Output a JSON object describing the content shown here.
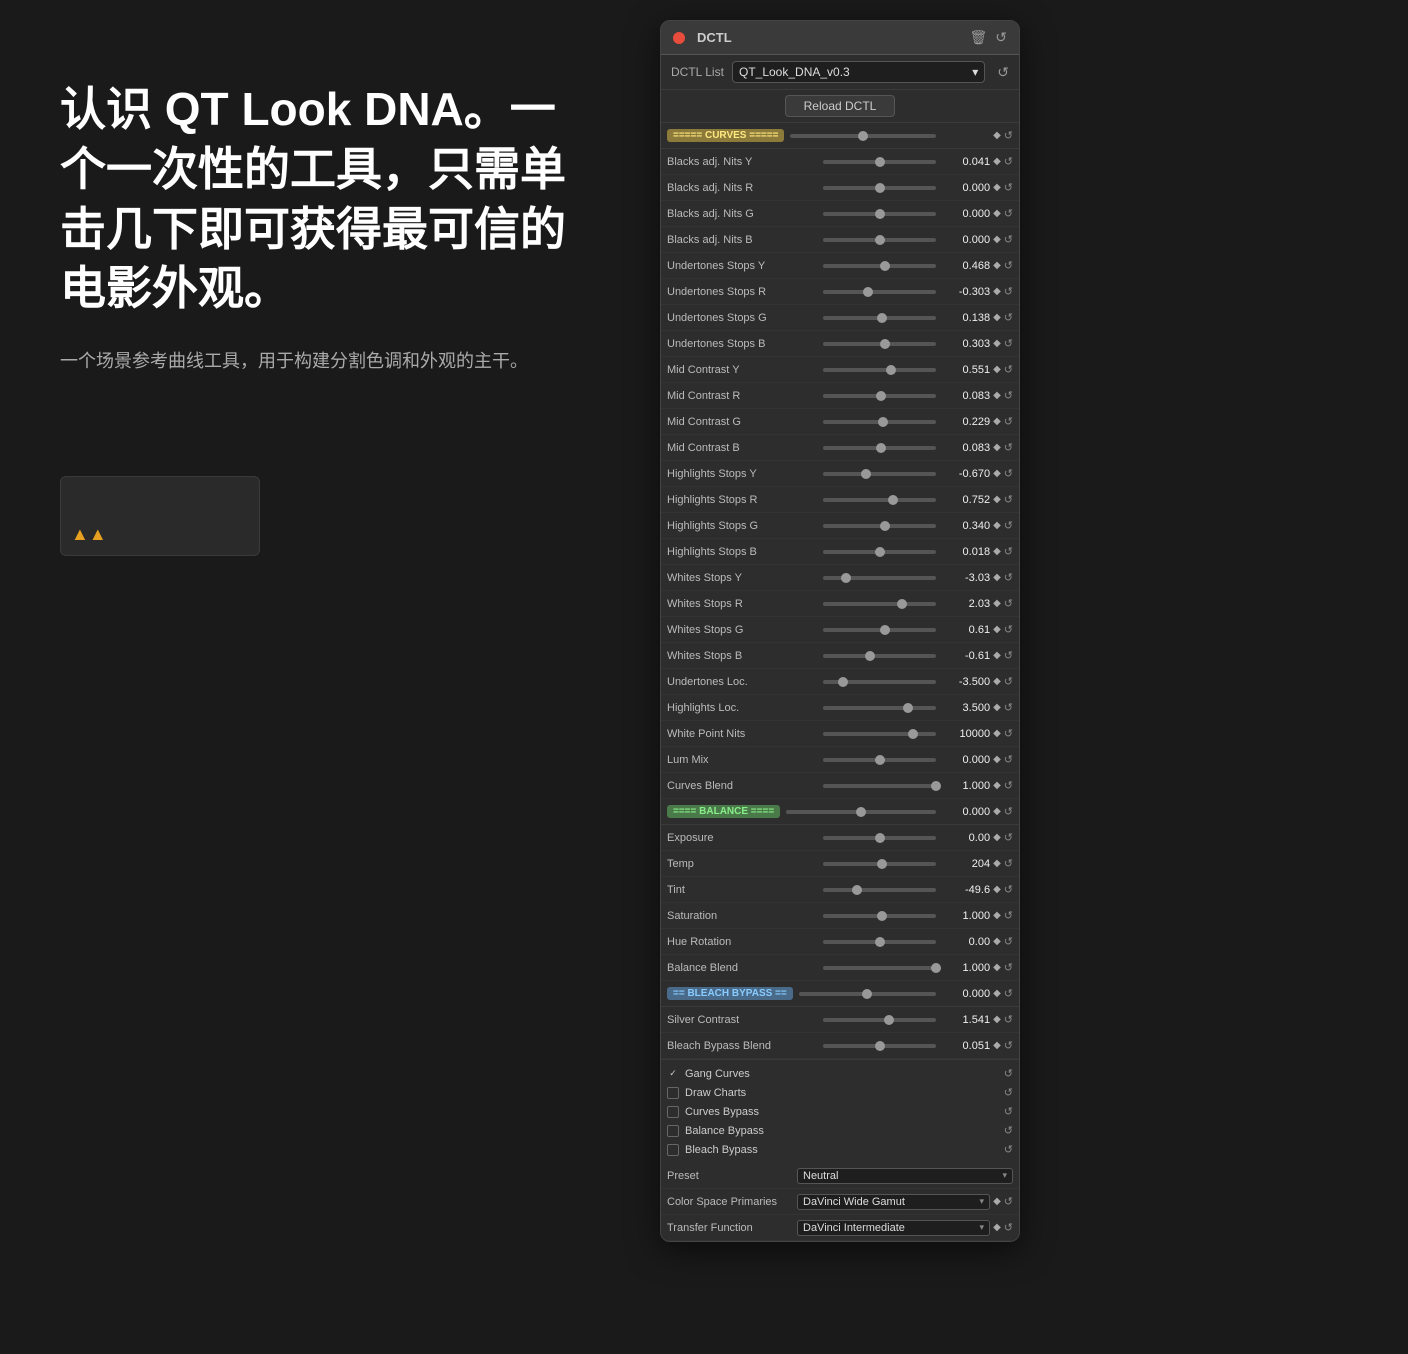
{
  "left": {
    "mainTitle": "认识 QT Look DNA。一个一次性的工具，只需单击几下即可获得最可信的电影外观。",
    "subtitle": "一个场景参考曲线工具，用于构建分割色调和外观的主干。"
  },
  "window": {
    "title": "DCTL",
    "dctlListLabel": "DCTL List",
    "dctlListValue": "QT_Look_DNA_v0.3",
    "reloadBtn": "Reload DCTL"
  },
  "sections": {
    "curves": "===== CURVES =====",
    "balance": "==== BALANCE ====",
    "bleach": "== BLEACH BYPASS =="
  },
  "params": [
    {
      "label": "===== CURVES =====",
      "type": "section",
      "badge": "curves",
      "value": ""
    },
    {
      "label": "Blacks adj. Nits Y",
      "type": "param",
      "value": "0.041",
      "thumbPos": 50
    },
    {
      "label": "Blacks adj. Nits R",
      "type": "param",
      "value": "0.000",
      "thumbPos": 50
    },
    {
      "label": "Blacks adj. Nits G",
      "type": "param",
      "value": "0.000",
      "thumbPos": 50
    },
    {
      "label": "Blacks adj. Nits B",
      "type": "param",
      "value": "0.000",
      "thumbPos": 50
    },
    {
      "label": "Undertones Stops Y",
      "type": "param",
      "value": "0.468",
      "thumbPos": 55
    },
    {
      "label": "Undertones Stops R",
      "type": "param",
      "value": "-0.303",
      "thumbPos": 40
    },
    {
      "label": "Undertones Stops G",
      "type": "param",
      "value": "0.138",
      "thumbPos": 52
    },
    {
      "label": "Undertones Stops B",
      "type": "param",
      "value": "0.303",
      "thumbPos": 55
    },
    {
      "label": "Mid Contrast Y",
      "type": "param",
      "value": "0.551",
      "thumbPos": 60
    },
    {
      "label": "Mid Contrast R",
      "type": "param",
      "value": "0.083",
      "thumbPos": 51
    },
    {
      "label": "Mid Contrast G",
      "type": "param",
      "value": "0.229",
      "thumbPos": 53
    },
    {
      "label": "Mid Contrast B",
      "type": "param",
      "value": "0.083",
      "thumbPos": 51
    },
    {
      "label": "Highlights Stops Y",
      "type": "param",
      "value": "-0.670",
      "thumbPos": 38
    },
    {
      "label": "Highlights Stops R",
      "type": "param",
      "value": "0.752",
      "thumbPos": 62
    },
    {
      "label": "Highlights Stops G",
      "type": "param",
      "value": "0.340",
      "thumbPos": 55
    },
    {
      "label": "Highlights Stops B",
      "type": "param",
      "value": "0.018",
      "thumbPos": 50
    },
    {
      "label": "Whites Stops Y",
      "type": "param",
      "value": "-3.03",
      "thumbPos": 20
    },
    {
      "label": "Whites Stops R",
      "type": "param",
      "value": "2.03",
      "thumbPos": 70
    },
    {
      "label": "Whites Stops G",
      "type": "param",
      "value": "0.61",
      "thumbPos": 55
    },
    {
      "label": "Whites Stops B",
      "type": "param",
      "value": "-0.61",
      "thumbPos": 42
    },
    {
      "label": "Undertones Loc.",
      "type": "param",
      "value": "-3.500",
      "thumbPos": 18
    },
    {
      "label": "Highlights Loc.",
      "type": "param",
      "value": "3.500",
      "thumbPos": 75
    },
    {
      "label": "White Point Nits",
      "type": "param",
      "value": "10000",
      "thumbPos": 80
    },
    {
      "label": "Lum Mix",
      "type": "param",
      "value": "0.000",
      "thumbPos": 50
    },
    {
      "label": "Curves Blend",
      "type": "param",
      "value": "1.000",
      "thumbPos": 100
    },
    {
      "label": "==== BALANCE ====",
      "type": "section",
      "badge": "balance",
      "value": "0.000"
    },
    {
      "label": "Exposure",
      "type": "param",
      "value": "0.00",
      "thumbPos": 50
    },
    {
      "label": "Temp",
      "type": "param",
      "value": "204",
      "thumbPos": 52
    },
    {
      "label": "Tint",
      "type": "param",
      "value": "-49.6",
      "thumbPos": 30
    },
    {
      "label": "Saturation",
      "type": "param",
      "value": "1.000",
      "thumbPos": 52
    },
    {
      "label": "Hue Rotation",
      "type": "param",
      "value": "0.00",
      "thumbPos": 50
    },
    {
      "label": "Balance Blend",
      "type": "param",
      "value": "1.000",
      "thumbPos": 100
    },
    {
      "label": "== BLEACH BYPASS ==",
      "type": "section",
      "badge": "bleach",
      "value": "0.000"
    },
    {
      "label": "Silver Contrast",
      "type": "param",
      "value": "1.541",
      "thumbPos": 58
    },
    {
      "label": "Bleach Bypass Blend",
      "type": "param",
      "value": "0.051",
      "thumbPos": 50
    }
  ],
  "checkboxes": [
    {
      "label": "Gang Curves",
      "checked": true
    },
    {
      "label": "Draw Charts",
      "checked": false
    },
    {
      "label": "Curves Bypass",
      "checked": false
    },
    {
      "label": "Balance Bypass",
      "checked": false
    },
    {
      "label": "Bleach Bypass",
      "checked": false
    }
  ],
  "selects": [
    {
      "label": "Preset",
      "value": "Neutral",
      "hasDiamond": false,
      "hasReset": false
    },
    {
      "label": "Color Space Primaries",
      "value": "DaVinci Wide Gamut",
      "hasDiamond": true,
      "hasReset": true
    },
    {
      "label": "Transfer Function",
      "value": "DaVinci Intermediate",
      "hasDiamond": true,
      "hasReset": true
    }
  ]
}
